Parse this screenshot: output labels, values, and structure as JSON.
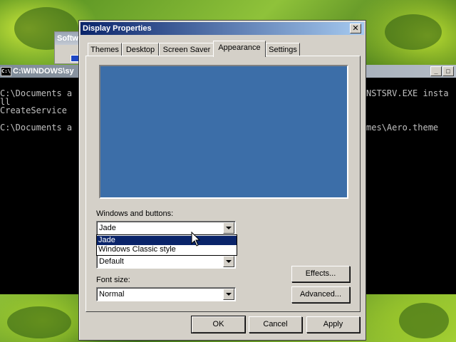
{
  "background_window": {
    "title": "Softw"
  },
  "console": {
    "title": "C:\\WINDOWS\\sy",
    "icon_text": "C:\\",
    "lines": [
      "C:\\Documents a",
      "ll",
      "CreateService",
      "",
      "C:\\Documents a"
    ],
    "right_lines": [
      "NSTSRV.EXE insta",
      "",
      "",
      "",
      "mes\\Aero.theme"
    ],
    "controls": [
      "_",
      "□"
    ]
  },
  "dialog": {
    "title": "Display Properties",
    "close_symbol": "✕",
    "tabs": [
      {
        "label": "Themes"
      },
      {
        "label": "Desktop"
      },
      {
        "label": "Screen Saver"
      },
      {
        "label": "Appearance"
      },
      {
        "label": "Settings"
      }
    ],
    "active_tab": "Appearance",
    "preview_color": "#3c6ea8",
    "windows_buttons": {
      "label": "Windows and buttons:",
      "value": "Jade",
      "options": [
        "Jade",
        "Windows Classic style"
      ],
      "selected": "Jade"
    },
    "color_scheme": {
      "value": "Default"
    },
    "font_size": {
      "label": "Font size:",
      "value": "Normal"
    },
    "buttons": {
      "effects": "Effects...",
      "advanced": "Advanced...",
      "ok": "OK",
      "cancel": "Cancel",
      "apply": "Apply"
    }
  },
  "colors": {
    "title_bar_start": "#0a246a",
    "title_bar_end": "#a6caf0",
    "selection": "#0a246a",
    "dialog_face": "#d4d0c8"
  }
}
